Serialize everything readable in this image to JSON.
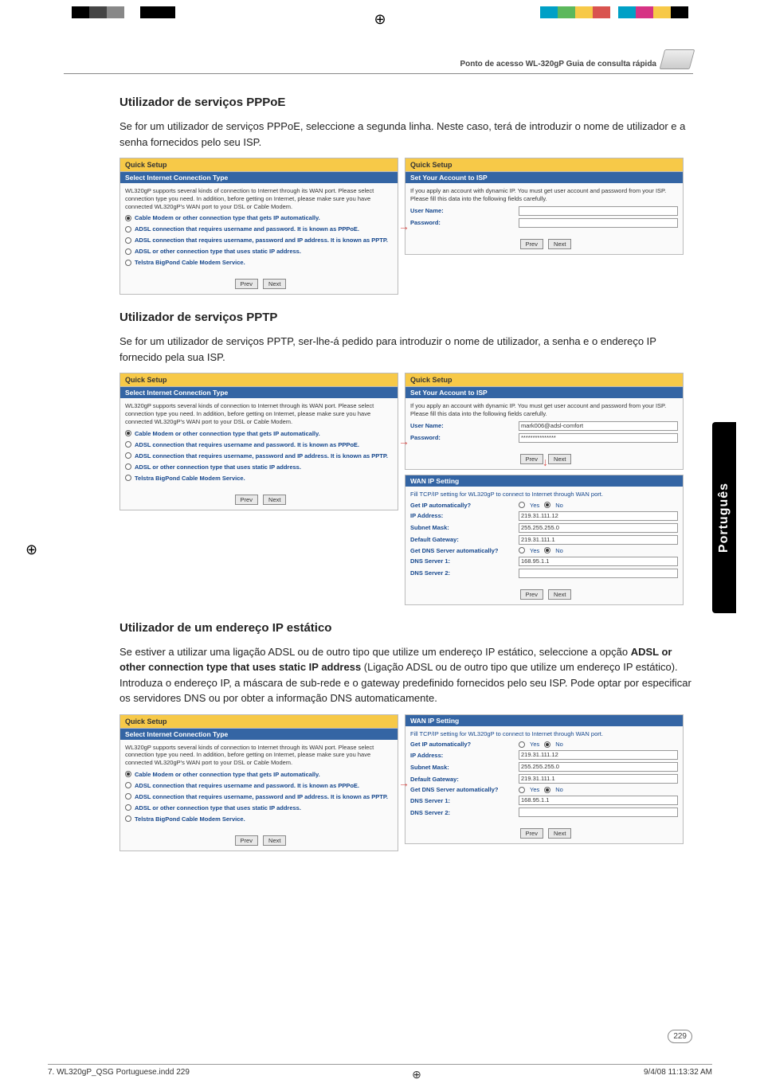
{
  "header": {
    "title": "Ponto de acesso WL-320gP Guia de consulta rápida"
  },
  "sideTab": "Português",
  "pageNumber": "229",
  "footer": {
    "leftFile": "7. WL320gP_QSG Portuguese.indd   229",
    "rightDate": "9/4/08   11:13:32 AM"
  },
  "sections": {
    "pppoe": {
      "heading": "Utilizador de serviços PPPoE",
      "para": "Se for um utilizador de serviços PPPoE, seleccione a segunda linha. Neste caso, terá de introduzir o nome de utilizador e a senha fornecidos pelo seu ISP."
    },
    "pptp": {
      "heading": "Utilizador de serviços PPTP",
      "para": "Se for um utilizador de serviços PPTP, ser-lhe-á pedido para introduzir o nome de utilizador, a senha e o endereço IP fornecido pela sua ISP."
    },
    "static": {
      "heading": "Utilizador de um endereço IP estático",
      "para1": "Se estiver a utilizar uma ligação ADSL ou de outro tipo que utilize um endereço IP estático, seleccione a opção ",
      "bold": "ADSL or other connection type that uses static IP address",
      "para2": " (Ligação ADSL ou de outro tipo que utilize um endereço IP estático). Introduza o endereço IP, a máscara de sub-rede e o gateway predefinido fornecidos pelo seu ISP. Pode optar por especificar os servidores DNS ou por obter a informação DNS automaticamente."
    }
  },
  "panels": {
    "quickSetup": "Quick Setup",
    "selectConnType": "Select Internet Connection Type",
    "setAccount": "Set Your Account to ISP",
    "wanIpSetting": "WAN IP Setting",
    "wl320desc": "WL320gP supports several kinds of connection to Internet through its WAN port. Please select connection type you need. In addition, before getting on Internet, please make sure you have connected WL320gP's WAN port to your DSL or Cable Modem.",
    "opt1": "Cable Modem or other connection type that gets IP automatically.",
    "opt2": "ADSL connection that requires username and password. It is known as PPPoE.",
    "opt3": "ADSL connection that requires username, password and IP address. It is known as PPTP.",
    "opt4": "ADSL or other connection type that uses static IP address.",
    "opt5": "Telstra BigPond Cable Modem Service.",
    "prev": "Prev",
    "next": "Next",
    "ispDesc": "If you apply an account with dynamic IP. You must get user account and password from your ISP. Please fill this data into the following fields carefully.",
    "userName": "User Name:",
    "password": "Password:",
    "userNameVal": "mark006@adsl-comfort",
    "passwordVal": "***************",
    "wanDesc": "Fill TCP/IP setting for WL320gP to connect to Internet through WAN port.",
    "getIpAuto": "Get IP automatically?",
    "ipAddress": "IP Address:",
    "subnetMask": "Subnet Mask:",
    "defaultGateway": "Default Gateway:",
    "getDnsAuto": "Get DNS Server automatically?",
    "dns1": "DNS Server 1:",
    "dns2": "DNS Server 2:",
    "yes": "Yes",
    "no": "No",
    "ipAddressVal": "219.31.111.12",
    "subnetMaskVal": "255.255.255.0",
    "defaultGatewayVal": "219.31.111.1",
    "dns1Val": "168.95.1.1"
  }
}
